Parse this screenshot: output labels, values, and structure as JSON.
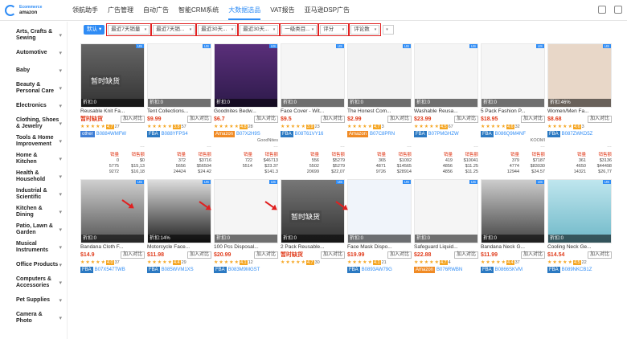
{
  "logo": {
    "line1": "Ecommerce",
    "line2": "amazon"
  },
  "nav": [
    "领航助手",
    "广告管理",
    "自动广告",
    "智能CRM系统",
    "大数据选品",
    "VAT报告",
    "亚马逊DSP广告"
  ],
  "nav_active_index": 4,
  "colors": {
    "accent": "#2f8cf5",
    "price": "#e03c1c",
    "highlight": "#e02020",
    "fba": "#2b79c2",
    "amazon": "#f08a24",
    "other": "#3f7ed6"
  },
  "sidebar": [
    "Arts, Crafts & Sewing",
    "Automotive",
    "Baby",
    "Beauty & Personal Care",
    "Electronics",
    "Clothing, Shoes & Jewelry",
    "Tools & Home Improvement",
    "Home & Kitchen",
    "Health & Household",
    "Industrial & Scientific",
    "Kitchen & Dining",
    "Patio, Lawn & Garden",
    "Musical Instruments",
    "Office Products",
    "Computers & Accessories",
    "Pet Supplies",
    "Camera & Photo"
  ],
  "filters": {
    "default_label": "默认",
    "selects": [
      "最近7天销量",
      "最近7天销...",
      "最近30天...",
      "最近30天...",
      "一级类目...",
      "评分",
      "评论数"
    ]
  },
  "card_labels": {
    "compare": "加入对比",
    "discount_prefix": "折扣:",
    "sales": "销量",
    "revenue": "销售额"
  },
  "row1": [
    {
      "title": "Reusable Knit Fa...",
      "out": "暂时缺货",
      "discount": "0",
      "price": "暂时缺货",
      "rating": "4.7",
      "reviews": "27",
      "src": "other",
      "asin": "B0884WMFW",
      "brand": "",
      "s1": "0",
      "s2": "$0",
      "r1": "5775",
      "r2": "$15,13",
      "t1": "9272",
      "t2": "$16,18"
    },
    {
      "title": "Tent Collections...",
      "out": "",
      "discount": "0",
      "price": "$9.99",
      "rating": "3.8",
      "reviews": "57",
      "src": "FBA",
      "asin": "B088YFPS4",
      "brand": "",
      "s1": "372",
      "s2": "$3716",
      "r1": "5656",
      "r2": "$56504",
      "t1": "24424",
      "t2": "$24.42"
    },
    {
      "title": "Goodnites Bedw...",
      "out": "",
      "discount": "0",
      "price": "$6.7",
      "rating": "4.8",
      "reviews": "28",
      "src": "Amazon",
      "asin": "B07X2H9S",
      "brand": "GoodNites",
      "s1": "722",
      "s2": "$46713",
      "r1": "5514",
      "r2": "$23.37",
      "t1": "",
      "t2": "$141.3"
    },
    {
      "title": "Face Cover - Wit...",
      "out": "",
      "discount": "0",
      "price": "$9.5",
      "rating": "3.9",
      "reviews": "23",
      "src": "FBA",
      "asin": "B08T61VY16",
      "brand": "",
      "s1": "556",
      "s2": "$5279",
      "r1": "5502",
      "r2": "$5279",
      "t1": "20699",
      "t2": "$22,07"
    },
    {
      "title": "The Honest Com...",
      "out": "",
      "discount": "0",
      "price": "$2.99",
      "rating": "4.7",
      "reviews": "3",
      "src": "Amazon",
      "asin": "B07C8PRN",
      "brand": "",
      "s1": "365",
      "s2": "$1092",
      "r1": "4871",
      "r2": "$14565",
      "t1": "9726",
      "t2": "$28914"
    },
    {
      "title": "Washable Reusa...",
      "out": "",
      "discount": "0",
      "price": "$23.99",
      "rating": "4.5",
      "reviews": "67",
      "src": "FBA",
      "asin": "B07PMGHZW",
      "brand": "",
      "s1": "419",
      "s2": "$10041",
      "r1": "4856",
      "r2": "$11.25",
      "t1": "4856",
      "t2": "$11.25"
    },
    {
      "title": "5 Pack Fashion P...",
      "out": "",
      "discount": "0",
      "price": "$18.95",
      "rating": "4.6",
      "reviews": "32",
      "src": "FBA",
      "asin": "B086Q9M4NF",
      "brand": "KOOMI",
      "s1": "379",
      "s2": "$7187",
      "r1": "4774",
      "r2": "$83030",
      "t1": "12944",
      "t2": "$24.57"
    },
    {
      "title": "Women/Men Fa...",
      "out": "",
      "discount": "46%",
      "price": "$8.68",
      "rating": "4.6",
      "reviews": "3",
      "src": "FBA",
      "asin": "B087ZWKD5Z",
      "brand": "",
      "s1": "361",
      "s2": "$3136",
      "r1": "4650",
      "r2": "$44498",
      "t1": "14321",
      "t2": "$26,77"
    }
  ],
  "row2": [
    {
      "title": "Bandana Cloth F...",
      "out": "",
      "discount": "0",
      "price": "$14.9",
      "rating": "4.0",
      "reviews": "37",
      "src": "FBA",
      "asin": "B07X547TWB"
    },
    {
      "title": "Motorcycle Face...",
      "out": "",
      "discount": "14%",
      "price": "$11.98",
      "rating": "4.4",
      "reviews": "29",
      "src": "FBA",
      "asin": "B085WVM1XS"
    },
    {
      "title": "100 Pcs Disposal...",
      "out": "",
      "discount": "0",
      "price": "$20.99",
      "rating": "4.1",
      "reviews": "12",
      "src": "FBA",
      "asin": "B083M9MGST"
    },
    {
      "title": "2 Pack Reusable...",
      "out": "暂时缺货",
      "discount": "0",
      "price": "暂时缺货",
      "rating": "4.7",
      "reviews": "30",
      "src": "",
      "asin": ""
    },
    {
      "title": "Face Mask Dispo...",
      "out": "",
      "discount": "0",
      "price": "$19.99",
      "rating": "4.1",
      "reviews": "21",
      "src": "FBA",
      "asin": "B0893AW79G"
    },
    {
      "title": "Safeguard Liquid...",
      "out": "",
      "discount": "0",
      "price": "$22.88",
      "rating": "4.7",
      "reviews": "4",
      "src": "Amazon",
      "asin": "B076RWBN"
    },
    {
      "title": "Bandana Neck G...",
      "out": "",
      "discount": "0",
      "price": "$11.99",
      "rating": "4.4",
      "reviews": "37",
      "src": "FBA",
      "asin": "B0866SKVM"
    },
    {
      "title": "Cooling Neck Ge...",
      "out": "",
      "discount": "0",
      "price": "$14.54",
      "rating": "4.5",
      "reviews": "22",
      "src": "FBA",
      "asin": "B089NKCB1Z"
    }
  ]
}
